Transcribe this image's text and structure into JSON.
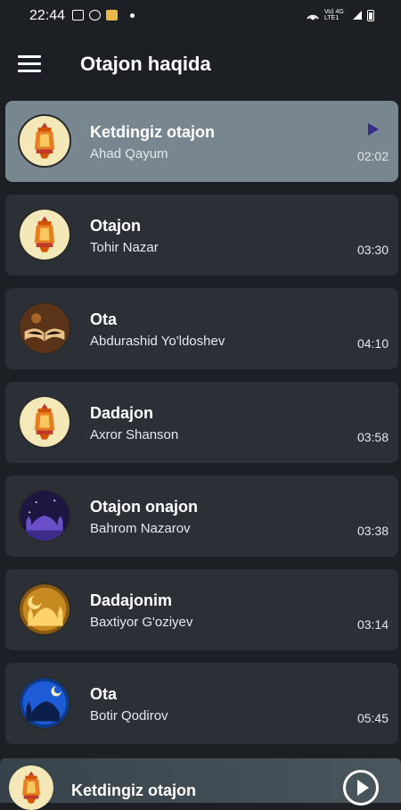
{
  "status_bar": {
    "time": "22:44",
    "right_text": "Vo) 4G LTE1"
  },
  "header": {
    "title": "Otajon haqida",
    "menu_icon": "hamburger-menu-icon"
  },
  "tracks": [
    {
      "title": "Ketdingiz otajon",
      "artist": "Ahad Qayum",
      "duration": "02:02",
      "art": "lantern",
      "active": true
    },
    {
      "title": "Otajon",
      "artist": "Tohir Nazar",
      "duration": "03:30",
      "art": "lantern",
      "active": false
    },
    {
      "title": "Ota",
      "artist": "Abdurashid Yo'ldoshev",
      "duration": "04:10",
      "art": "book",
      "active": false
    },
    {
      "title": "Dadajon",
      "artist": "Axror Shanson",
      "duration": "03:58",
      "art": "lantern",
      "active": false
    },
    {
      "title": "Otajon onajon",
      "artist": "Bahrom Nazarov",
      "duration": "03:38",
      "art": "mosque-purple",
      "active": false
    },
    {
      "title": "Dadajonim",
      "artist": "Baxtiyor G'oziyev",
      "duration": "03:14",
      "art": "mosque-gold",
      "active": false
    },
    {
      "title": "Ota",
      "artist": "Botir Qodirov",
      "duration": "05:45",
      "art": "mosque-blue",
      "active": false
    }
  ],
  "player": {
    "title": "Ketdingiz otajon",
    "play_icon": "play-circle-icon"
  },
  "colors": {
    "background": "#1c2024",
    "card": "#2a3036",
    "active_card": "#78868f",
    "play_accent": "#3a2a8c"
  }
}
